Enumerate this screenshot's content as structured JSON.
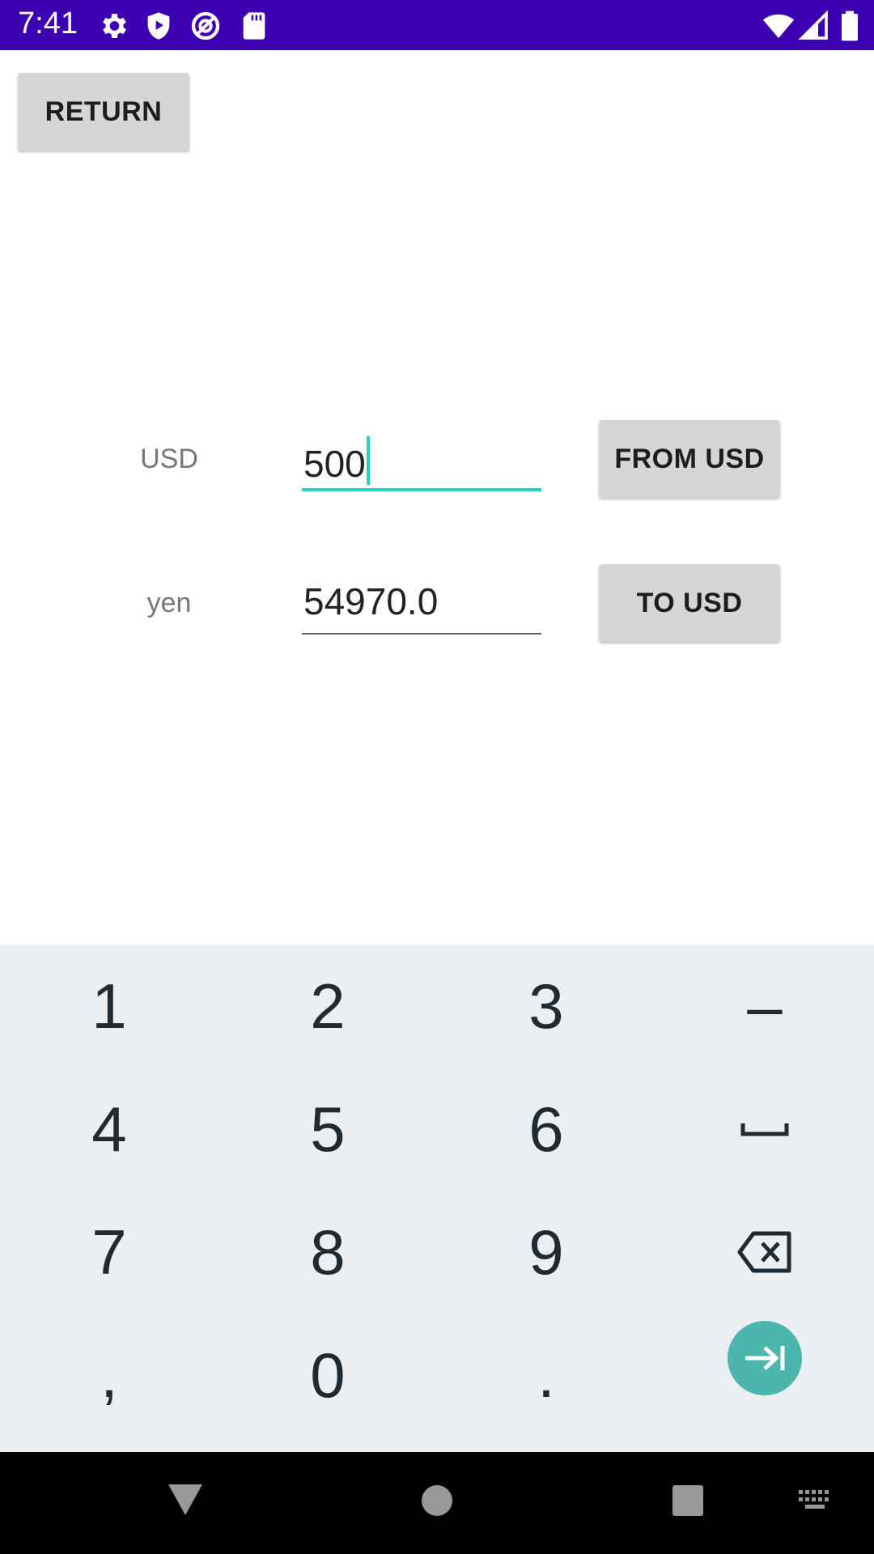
{
  "status_bar": {
    "time": "7:41",
    "left_icons": [
      "gear-icon",
      "shield-play-icon",
      "vpn-circle-icon",
      "sd-card-icon"
    ],
    "right_icons": [
      "wifi-icon",
      "cell-signal-icon",
      "battery-icon"
    ],
    "background": "#3d00b0"
  },
  "header": {
    "return_label": "RETURN"
  },
  "converter": {
    "usd_label": "USD",
    "usd_value": "500",
    "from_usd_label": "FROM USD",
    "yen_label": "yen",
    "yen_value": "54970.0",
    "to_usd_label": "TO USD",
    "focus_color": "#1fd4c4"
  },
  "keyboard": {
    "rows": [
      [
        "1",
        "2",
        "3",
        "–"
      ],
      [
        "4",
        "5",
        "6",
        "space-icon"
      ],
      [
        "7",
        "8",
        "9",
        "backspace-icon"
      ],
      [
        ",",
        "0",
        ".",
        "next-field-icon"
      ]
    ],
    "accent": "#4db6ac"
  },
  "nav_bar": {
    "icons": [
      "back-triangle-icon",
      "home-circle-icon",
      "recents-square-icon",
      "keyboard-switch-icon"
    ]
  }
}
